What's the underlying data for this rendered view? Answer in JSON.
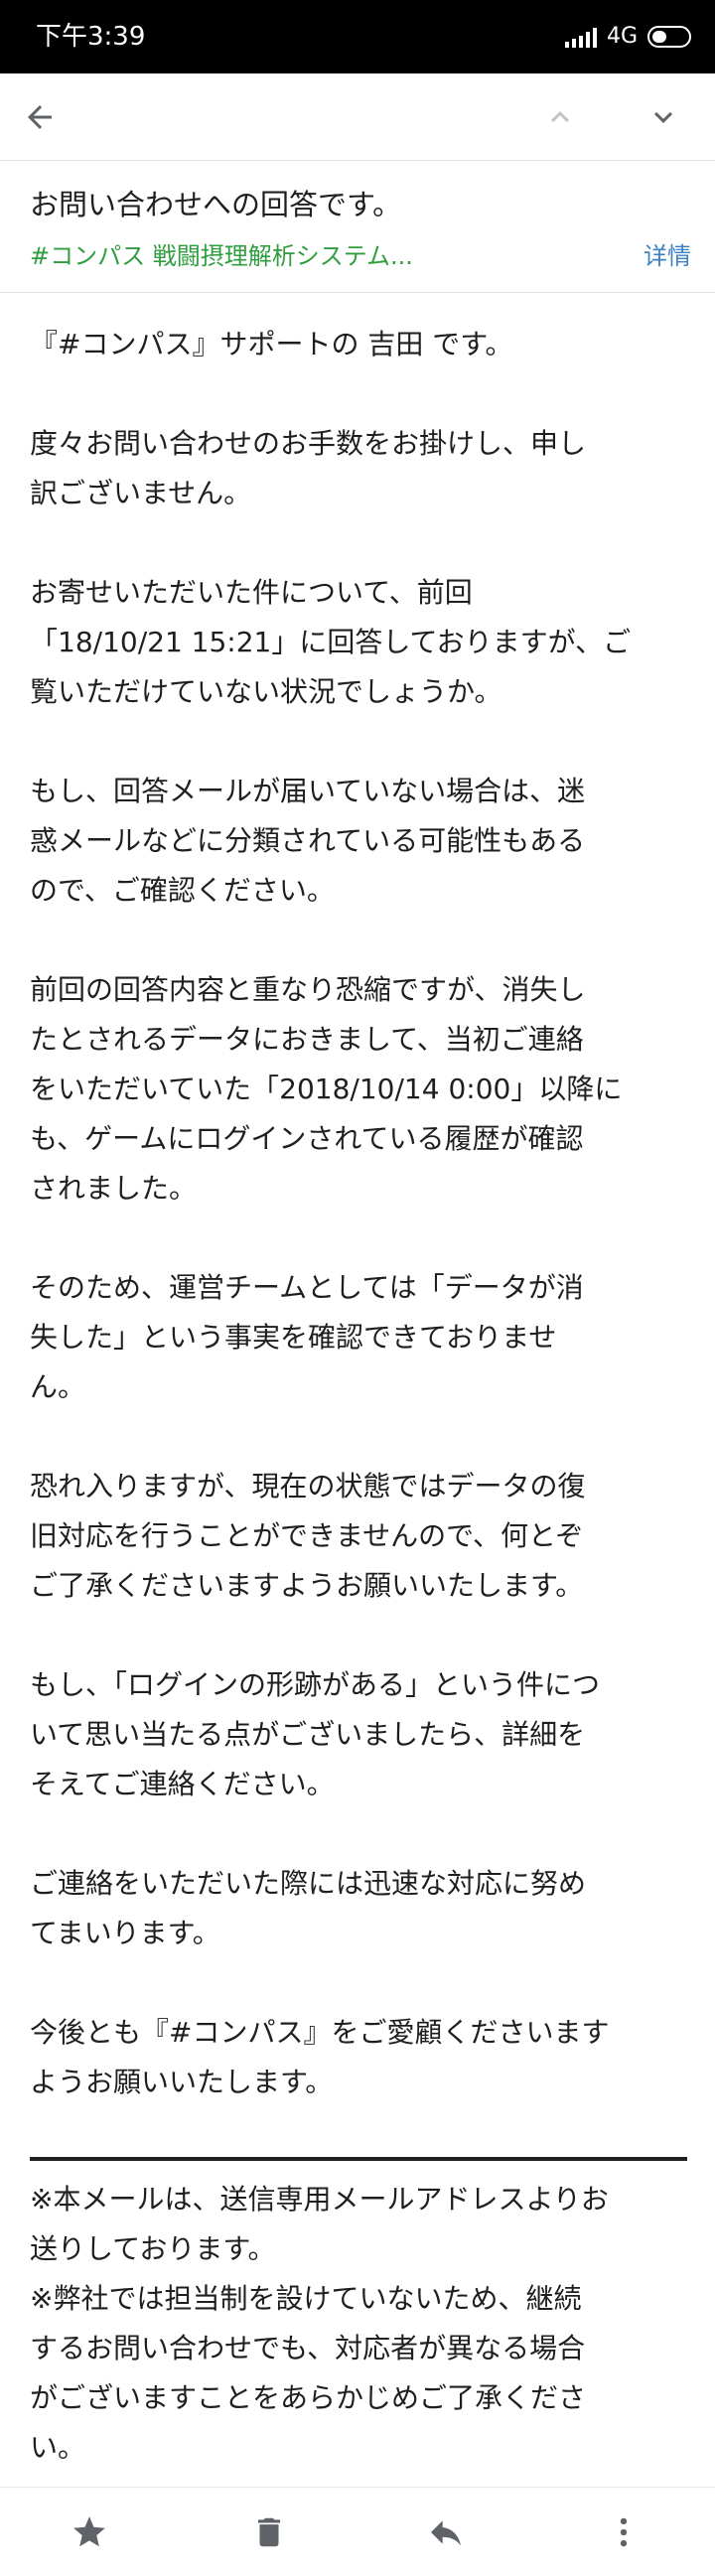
{
  "status_bar": {
    "time": "下午3:39",
    "network": "4G",
    "icons": [
      "signal-icon",
      "battery-icon"
    ]
  },
  "toolbar": {
    "icons": [
      "arrow-back-icon",
      "chevron-up-icon",
      "chevron-down-icon"
    ]
  },
  "email": {
    "subject": "お問い合わせへの回答です。",
    "label": "#コンパス 戦闘摂理解析システム...",
    "details_link": "详情",
    "label_color": "#2f9e3f",
    "link_color": "#3b82c4",
    "paragraphs": [
      [
        "『#コンパス』サポートの 吉田 です。"
      ],
      [
        "度々お問い合わせのお手数をお掛けし、申し",
        "訳ございません。"
      ],
      [
        "お寄せいただいた件について、前回",
        "「18/10/21 15:21」に回答しておりますが、ご",
        "覧いただけていない状況でしょうか。"
      ],
      [
        "もし、回答メールが届いていない場合は、迷",
        "惑メールなどに分類されている可能性もある",
        "ので、ご確認ください。"
      ],
      [
        "前回の回答内容と重なり恐縮ですが、消失し",
        "たとされるデータにおきまして、当初ご連絡",
        "をいただいていた「2018/10/14  0:00」以降に",
        "も、ゲームにログインされている履歴が確認",
        "されました。"
      ],
      [
        "そのため、運営チームとしては「データが消",
        "失した」という事実を確認できておりませ",
        "ん。"
      ],
      [
        "恐れ入りますが、現在の状態ではデータの復",
        "旧対応を行うことができませんので、何とぞ",
        "ご了承くださいますようお願いいたします。"
      ],
      [
        "もし、「ログインの形跡がある」という件につ",
        "いて思い当たる点がございましたら、詳細を",
        "そえてご連絡ください。"
      ],
      [
        "ご連絡をいただいた際には迅速な対応に努め",
        "てまいります。"
      ],
      [
        "今後とも『#コンパス』をご愛顧くださいます",
        "ようお願いいたします。"
      ]
    ],
    "footer": [
      "※本メールは、送信専用メールアドレスよりお",
      "送りしております。",
      "※弊社では担当制を設けていないため、継続",
      "するお問い合わせでも、対応者が異なる場合",
      "がございますことをあらかじめご了承くださ",
      "い。"
    ]
  },
  "bottom_bar": {
    "icons": [
      "star-icon",
      "delete-icon",
      "reply-icon",
      "more-vert-icon"
    ]
  }
}
